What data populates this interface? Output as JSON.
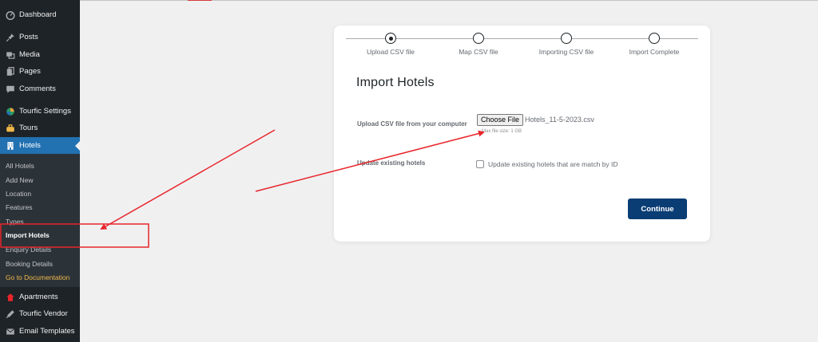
{
  "sidebar": {
    "items": [
      {
        "label": "Dashboard",
        "icon": "dashboard-icon"
      },
      {
        "label": "Posts",
        "icon": "pin-icon"
      },
      {
        "label": "Media",
        "icon": "media-icon"
      },
      {
        "label": "Pages",
        "icon": "pages-icon"
      },
      {
        "label": "Comments",
        "icon": "comments-icon"
      },
      {
        "label": "Tourfic Settings",
        "icon": "tourfic-icon"
      },
      {
        "label": "Tours",
        "icon": "tours-icon"
      },
      {
        "label": "Hotels",
        "icon": "hotels-icon"
      },
      {
        "label": "Apartments",
        "icon": "apartments-icon"
      },
      {
        "label": "Tourfic Vendor",
        "icon": "vendor-icon"
      },
      {
        "label": "Email Templates",
        "icon": "email-icon"
      }
    ],
    "submenu": [
      {
        "label": "All Hotels"
      },
      {
        "label": "Add New"
      },
      {
        "label": "Location"
      },
      {
        "label": "Features"
      },
      {
        "label": "Types"
      },
      {
        "label": "Import Hotels"
      },
      {
        "label": "Enquiry Details"
      },
      {
        "label": "Booking Details"
      },
      {
        "label": "Go to Documentation"
      }
    ]
  },
  "steps": [
    {
      "label": "Upload CSV file"
    },
    {
      "label": "Map CSV file"
    },
    {
      "label": "Importing CSV file"
    },
    {
      "label": "Import Complete"
    }
  ],
  "form": {
    "title": "Import Hotels",
    "upload_label": "Upload CSV file from your computer",
    "choose_file_label": "Choose File",
    "file_name": "Hotels_11-5-2023.csv",
    "max_size": "Max file size: 1 GB",
    "update_label": "Update existing hotels",
    "update_checkbox_label": "Update existing hotels that are match by ID",
    "continue_label": "Continue"
  },
  "colors": {
    "sidebar_bg": "#1d2327",
    "active": "#2271b1",
    "primary_button": "#0a3d74",
    "annotation": "#e8252b",
    "documentation_link": "#f0b849"
  }
}
